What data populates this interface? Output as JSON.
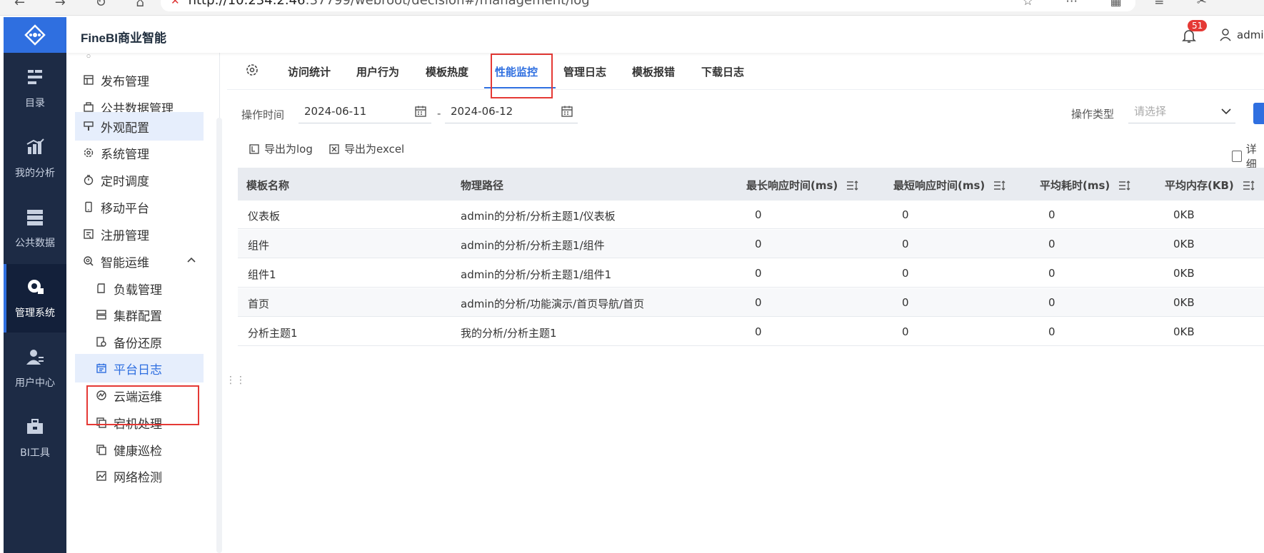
{
  "browser": {
    "url_prefix": "http://10.234.2.46",
    "url_rest": ":37799/webroot/decision#/management/log"
  },
  "app": {
    "title": "FineBI商业智能",
    "notification_count": "51",
    "username": "admin"
  },
  "rail": {
    "items": [
      {
        "label": "目录",
        "icon": "catalog-icon"
      },
      {
        "label": "我的分析",
        "icon": "analysis-icon"
      },
      {
        "label": "公共数据",
        "icon": "database-icon"
      },
      {
        "label": "管理系统",
        "icon": "gear-admin-icon",
        "active": true
      },
      {
        "label": "用户中心",
        "icon": "user-center-icon"
      },
      {
        "label": "BI工具",
        "icon": "toolbox-icon"
      }
    ]
  },
  "sidebar": {
    "items": [
      {
        "label": "发布管理",
        "icon": "publish-icon"
      },
      {
        "label": "公共数据管理",
        "icon": "public-data-icon"
      },
      {
        "label": "外观配置",
        "icon": "brush-icon",
        "highlight": true
      },
      {
        "label": "系统管理",
        "icon": "gear-icon"
      },
      {
        "label": "定时调度",
        "icon": "timer-icon"
      },
      {
        "label": "移动平台",
        "icon": "mobile-icon"
      },
      {
        "label": "注册管理",
        "icon": "register-icon"
      },
      {
        "label": "智能运维",
        "icon": "ops-icon",
        "expanded": true
      },
      {
        "label": "负载管理",
        "icon": "card-icon",
        "sub": true
      },
      {
        "label": "集群配置",
        "icon": "cluster-icon",
        "sub": true
      },
      {
        "label": "备份还原",
        "icon": "backup-icon",
        "sub": true
      },
      {
        "label": "平台日志",
        "icon": "calendar-log-icon",
        "sub": true,
        "selected": true
      },
      {
        "label": "云端运维",
        "icon": "cloud-icon",
        "sub": true
      },
      {
        "label": "宕机处理",
        "icon": "copy-icon",
        "sub": true
      },
      {
        "label": "健康巡检",
        "icon": "health-icon",
        "sub": true
      },
      {
        "label": "网络检测",
        "icon": "network-icon",
        "sub": true
      }
    ]
  },
  "tabs": [
    {
      "label": "访问统计"
    },
    {
      "label": "用户行为"
    },
    {
      "label": "模板热度"
    },
    {
      "label": "性能监控",
      "active": true
    },
    {
      "label": "管理日志"
    },
    {
      "label": "模板报错"
    },
    {
      "label": "下载日志"
    }
  ],
  "filters": {
    "time_label": "操作时间",
    "start_date": "2024-06-11",
    "separator": "-",
    "end_date": "2024-06-12",
    "type_label": "操作类型",
    "type_placeholder": "请选择"
  },
  "actions": {
    "export_log": "导出为log",
    "export_excel": "导出为excel",
    "detail_label": "详细"
  },
  "table": {
    "headers": [
      "模板名称",
      "物理路径",
      "最长响应时间(ms)",
      "最短响应时间(ms)",
      "平均耗时(ms)",
      "平均内存(KB)"
    ],
    "rows": [
      [
        "仪表板",
        "admin的分析/分析主题1/仪表板",
        "0",
        "0",
        "0",
        "0KB"
      ],
      [
        "组件",
        "admin的分析/分析主题1/组件",
        "0",
        "0",
        "0",
        "0KB"
      ],
      [
        "组件1",
        "admin的分析/分析主题1/组件1",
        "0",
        "0",
        "0",
        "0KB"
      ],
      [
        "首页",
        "admin的分析/功能演示/首页导航/首页",
        "0",
        "0",
        "0",
        "0KB"
      ],
      [
        "分析主题1",
        "我的分析/分析主题1",
        "0",
        "0",
        "0",
        "0KB"
      ]
    ]
  },
  "colors": {
    "accent": "#2f6fe0",
    "rail_bg": "#1d2b45",
    "annotation_red": "#e53935"
  }
}
